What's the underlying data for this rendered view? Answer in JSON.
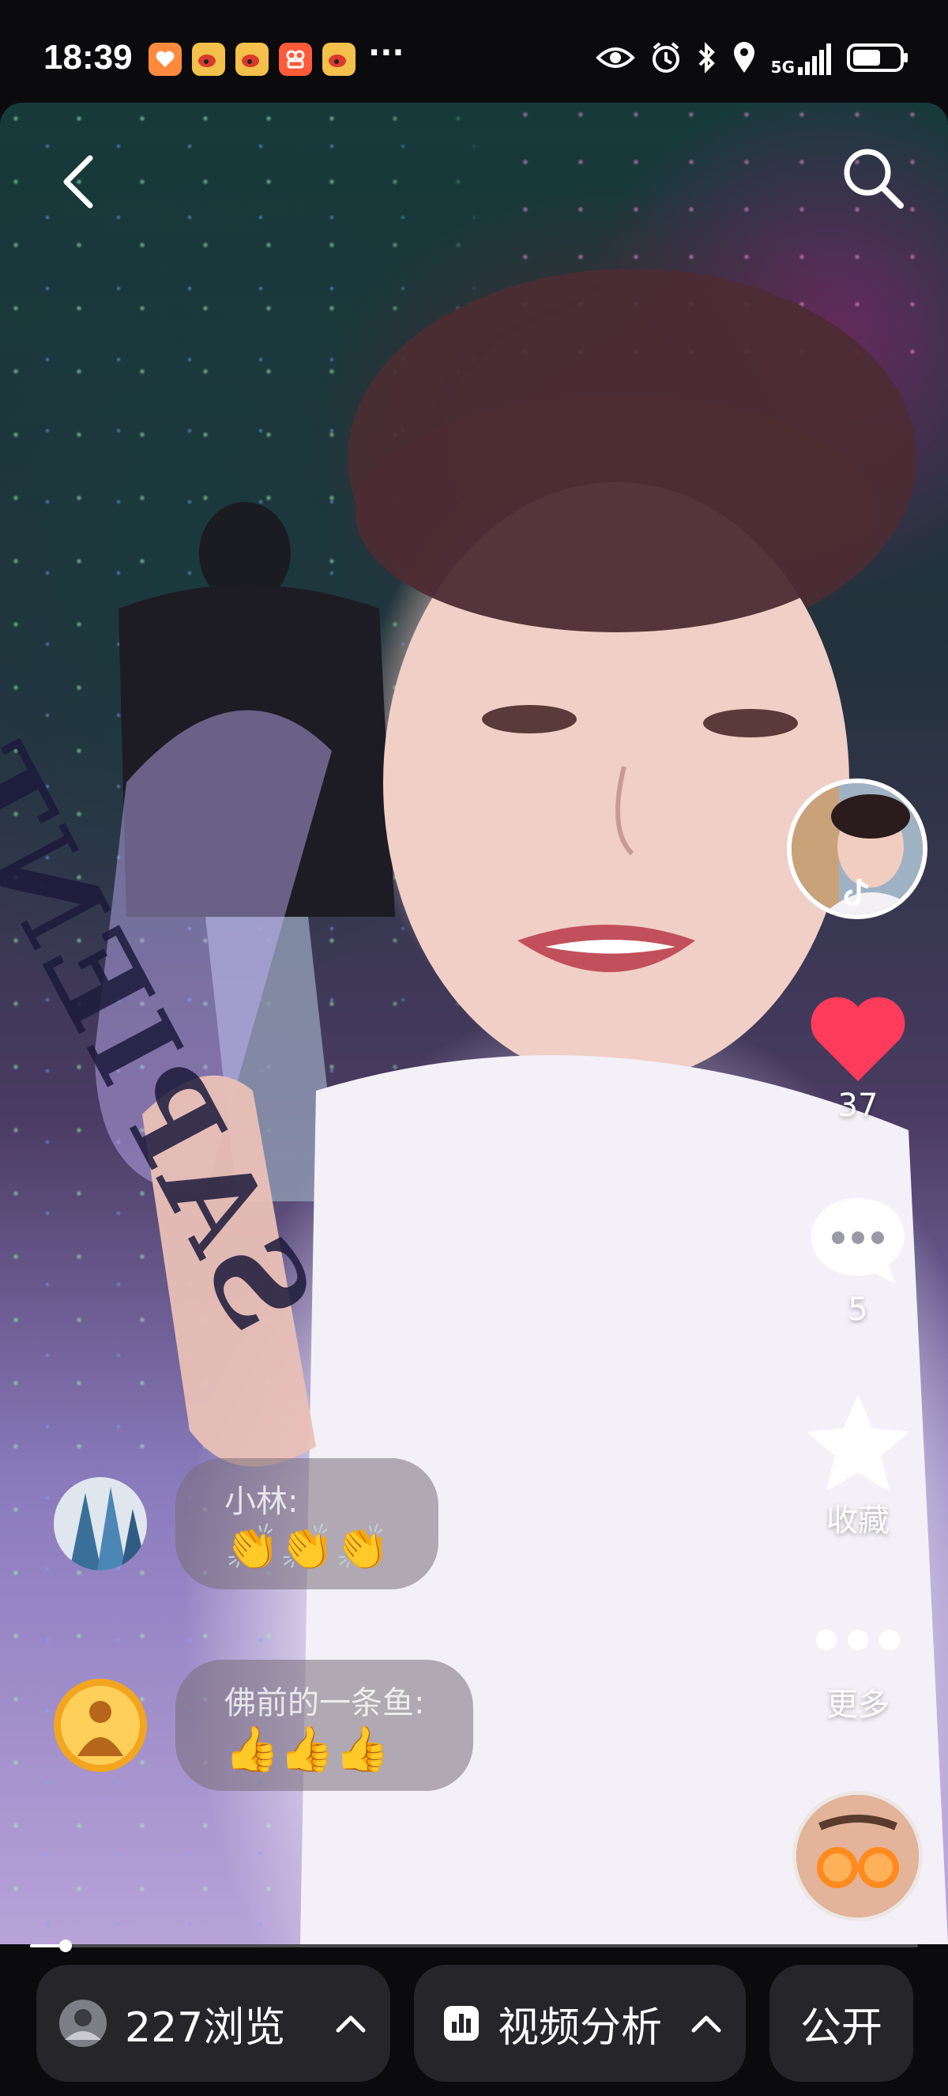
{
  "status_bar": {
    "time": "18:39",
    "network": "5G",
    "more": "···"
  },
  "video": {
    "shirt_text": "SAPIENT"
  },
  "actions": {
    "likes": "37",
    "comments": "5",
    "favorite_label": "收藏",
    "more_label": "更多"
  },
  "comments": [
    {
      "name": "小林:",
      "text": "👏👏👏"
    },
    {
      "name": "佛前的一条鱼:",
      "text": "👍👍👍"
    }
  ],
  "progress": {
    "fraction": 0.04
  },
  "bottom_bar": {
    "views_label": "227浏览",
    "analysis_label": "视频分析",
    "visibility_label": "公开"
  },
  "colors": {
    "like": "#ff3b5c",
    "bottom_pill": "#25252a",
    "background": "#0b0b0d"
  }
}
